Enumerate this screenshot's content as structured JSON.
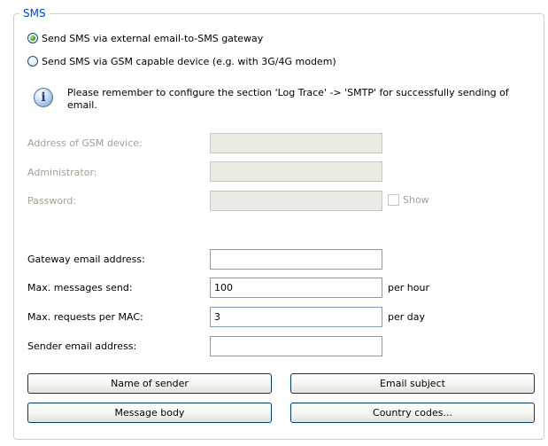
{
  "group": {
    "title": "SMS"
  },
  "options": {
    "radio_email_label": "Send SMS via external email-to-SMS gateway",
    "radio_gsm_label": "Send SMS via GSM capable device (e.g. with 3G/4G modem)",
    "selected": "email"
  },
  "info": {
    "icon": "info-icon",
    "text": "Please remember to configure the section 'Log  Trace' -> 'SMTP' for successfully sending of email."
  },
  "gsm": {
    "address_label": "Address of GSM device:",
    "address_value": "",
    "admin_label": "Administrator:",
    "admin_value": "",
    "password_label": "Password:",
    "password_value": "",
    "show_label": "Show",
    "show_checked": false
  },
  "gateway": {
    "email_label": "Gateway email address:",
    "email_value": "",
    "max_messages_label": "Max. messages send:",
    "max_messages_value": "100",
    "max_messages_unit": "per hour",
    "max_requests_label": "Max. requests per MAC:",
    "max_requests_value": "3",
    "max_requests_unit": "per day",
    "sender_label": "Sender email address:",
    "sender_value": ""
  },
  "buttons": {
    "name_of_sender": "Name of sender",
    "email_subject": "Email subject",
    "message_body": "Message body",
    "country_codes": "Country codes..."
  },
  "colors": {
    "legend": "#0046d5",
    "disabled_text": "#a1a192",
    "group_border": "#d0d0bf",
    "field_border": "#7f9db9",
    "button_border": "#003c74"
  }
}
